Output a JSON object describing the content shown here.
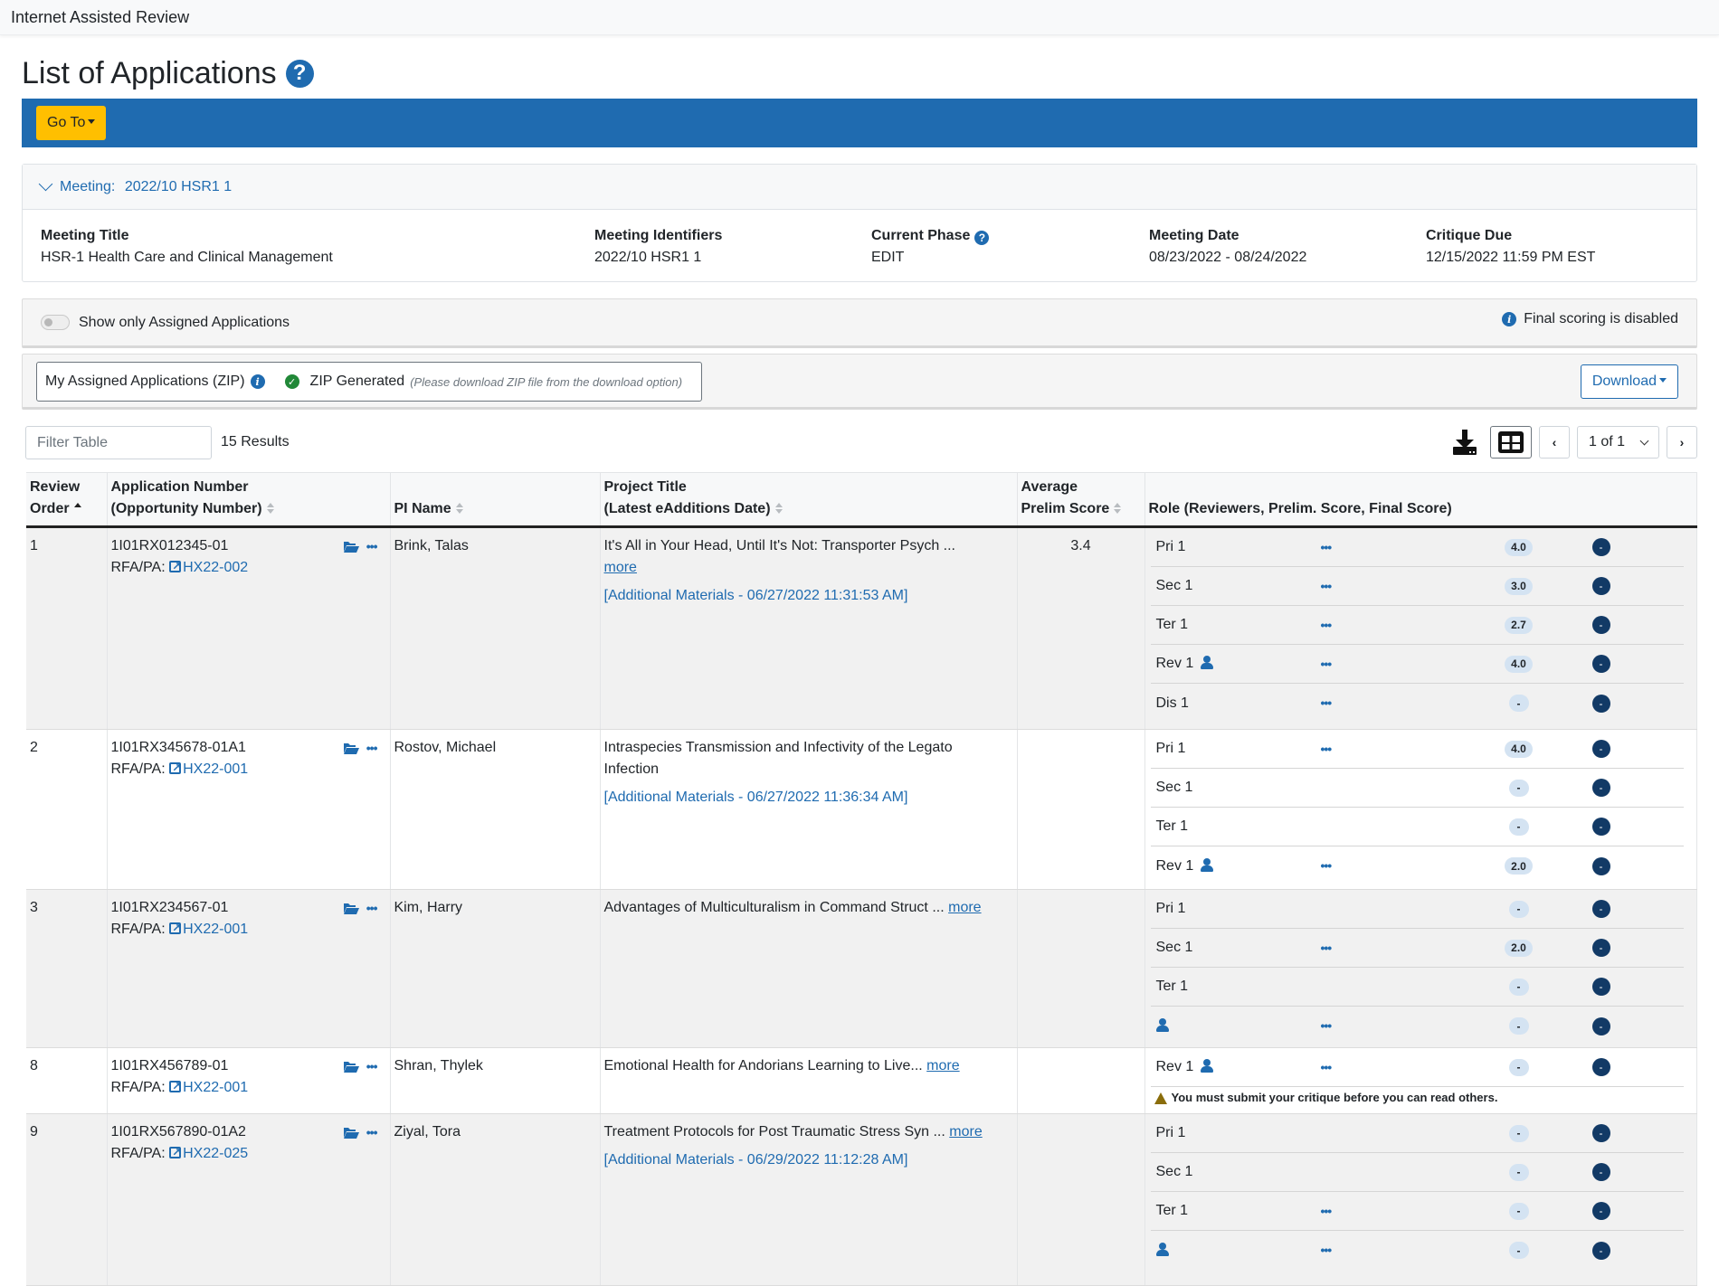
{
  "app": {
    "title": "Internet Assisted Review"
  },
  "page": {
    "title": "List of Applications",
    "help_icon": "question-circle-icon"
  },
  "toolbar": {
    "goto_label": "Go To"
  },
  "meeting": {
    "header_label": "Meeting:",
    "header_value": "2022/10 HSR1 1",
    "fields": [
      {
        "label": "Meeting Title",
        "value": "HSR-1 Health Care and Clinical Management"
      },
      {
        "label": "Meeting Identifiers",
        "value": "2022/10 HSR1 1"
      },
      {
        "label": "Current Phase",
        "value": "EDIT"
      },
      {
        "label": "Meeting Date",
        "value": "08/23/2022 - 08/24/2022"
      },
      {
        "label": "Critique Due",
        "value": "12/15/2022 11:59 PM EST"
      }
    ]
  },
  "filters": {
    "assigned_toggle_label": "Show only Assigned Applications",
    "assigned_toggle_on": false,
    "final_scoring_note": "Final scoring is disabled"
  },
  "zip": {
    "label": "My Assigned Applications (ZIP)",
    "status": "ZIP Generated",
    "hint": "(Please download ZIP file from the download option)",
    "download_label": "Download"
  },
  "table_controls": {
    "filter_placeholder": "Filter Table",
    "results": "15 Results",
    "page_indicator": "1 of 1"
  },
  "table": {
    "headers": {
      "review_order": [
        "Review",
        "Order"
      ],
      "application": [
        "Application Number",
        "(Opportunity Number)"
      ],
      "pi": "PI Name",
      "title": [
        "Project Title",
        "(Latest eAdditions Date)"
      ],
      "avg": [
        "Average",
        "Prelim Score"
      ],
      "role": "Role (Reviewers, Prelim. Score, Final Score)"
    },
    "rfa_prefix": "RFA/PA:",
    "more_label": "more",
    "rows": [
      {
        "order": "1",
        "app_number": "1I01RX012345-01",
        "rfa": "HX22-002",
        "pi": "Brink, Talas",
        "title": "It's All in Your Head, Until It's Not: Transporter Psych ...",
        "has_more": true,
        "additional": "[Additional Materials - 06/27/2022 11:31:53 AM]",
        "avg": "3.4",
        "roles": [
          {
            "role": "Pri 1",
            "me": false,
            "menu": true,
            "prelim": "4.0",
            "final": "-"
          },
          {
            "role": "Sec 1",
            "me": false,
            "menu": true,
            "prelim": "3.0",
            "final": "-"
          },
          {
            "role": "Ter 1",
            "me": false,
            "menu": true,
            "prelim": "2.7",
            "final": "-"
          },
          {
            "role": "Rev 1",
            "me": true,
            "menu": true,
            "prelim": "4.0",
            "final": "-"
          },
          {
            "role": "Dis 1",
            "me": false,
            "menu": true,
            "prelim": "-",
            "final": "-"
          }
        ]
      },
      {
        "order": "2",
        "app_number": "1I01RX345678-01A1",
        "rfa": "HX22-001",
        "pi": "Rostov, Michael",
        "title": "Intraspecies Transmission and Infectivity of the Legato Infection",
        "has_more": false,
        "additional": "[Additional Materials - 06/27/2022 11:36:34 AM]",
        "avg": "",
        "roles": [
          {
            "role": "Pri 1",
            "me": false,
            "menu": true,
            "prelim": "4.0",
            "final": "-"
          },
          {
            "role": "Sec 1",
            "me": false,
            "menu": false,
            "prelim": "-",
            "final": "-"
          },
          {
            "role": "Ter 1",
            "me": false,
            "menu": false,
            "prelim": "-",
            "final": "-"
          },
          {
            "role": "Rev 1",
            "me": true,
            "menu": true,
            "prelim": "2.0",
            "final": "-"
          }
        ]
      },
      {
        "order": "3",
        "app_number": "1I01RX234567-01",
        "rfa": "HX22-001",
        "pi": "Kim, Harry",
        "title": "Advantages of Multiculturalism in Command Struct ...",
        "has_more": true,
        "additional": "",
        "avg": "",
        "roles": [
          {
            "role": "Pri 1",
            "me": false,
            "menu": false,
            "prelim": "-",
            "final": "-"
          },
          {
            "role": "Sec 1",
            "me": false,
            "menu": true,
            "prelim": "2.0",
            "final": "-"
          },
          {
            "role": "Ter 1",
            "me": false,
            "menu": false,
            "prelim": "-",
            "final": "-"
          },
          {
            "role": "",
            "me": true,
            "menu": true,
            "prelim": "-",
            "final": "-"
          }
        ]
      },
      {
        "order": "8",
        "app_number": "1I01RX456789-01",
        "rfa": "HX22-001",
        "pi": "Shran, Thylek",
        "title": "Emotional Health for Andorians Learning to Live...",
        "has_more": true,
        "additional": "",
        "avg": "",
        "roles": [
          {
            "role": "Rev 1",
            "me": true,
            "menu": true,
            "prelim": "-",
            "final": "-"
          }
        ],
        "warning": "You must submit your critique before you can read others."
      },
      {
        "order": "9",
        "app_number": "1I01RX567890-01A2",
        "rfa": "HX22-025",
        "pi": "Ziyal, Tora",
        "title": "Treatment Protocols for Post Traumatic Stress Syn ...",
        "has_more": true,
        "additional": "[Additional Materials - 06/29/2022 11:12:28 AM]",
        "avg": "",
        "roles": [
          {
            "role": "Pri 1",
            "me": false,
            "menu": false,
            "prelim": "-",
            "final": "-"
          },
          {
            "role": "Sec 1",
            "me": false,
            "menu": false,
            "prelim": "-",
            "final": "-"
          },
          {
            "role": "Ter 1",
            "me": false,
            "menu": true,
            "prelim": "-",
            "final": "-"
          },
          {
            "role": "",
            "me": true,
            "menu": true,
            "prelim": "-",
            "final": "-"
          }
        ]
      }
    ]
  },
  "colors": {
    "brand_blue": "#1f6bb0",
    "goto_yellow": "#ffbf00",
    "final_badge": "#123a66",
    "prelim_badge": "#d4e3f2",
    "success_green": "#218838",
    "warning": "#8a6d0b"
  }
}
